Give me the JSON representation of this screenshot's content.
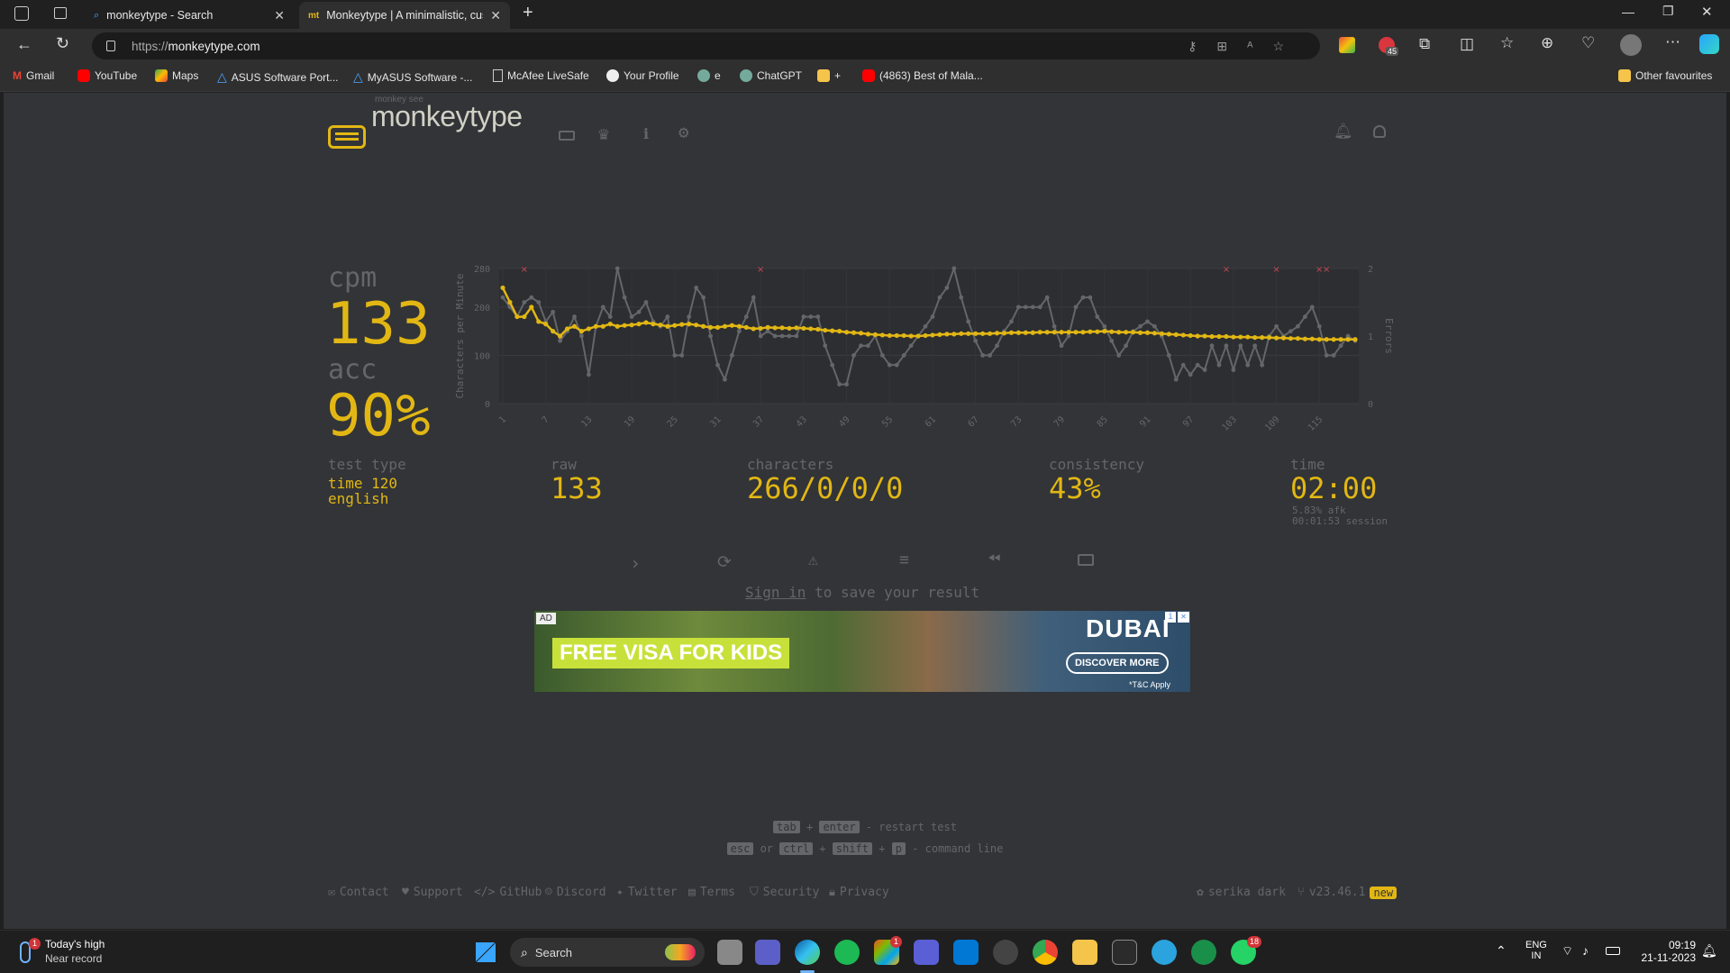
{
  "browser": {
    "tabs": [
      {
        "label": "monkeytype - Search",
        "favicon": "search-icon"
      },
      {
        "label": "Monkeytype | A minimalistic, cus",
        "favicon": "mt"
      }
    ],
    "url_prefix": "https://",
    "url_host": "monkeytype.com",
    "extension_badge": "45",
    "bookmarks": [
      "Gmail",
      "YouTube",
      "Maps",
      "ASUS Software Port...",
      "MyASUS Software -...",
      "McAfee LiveSafe",
      "Your Profile",
      "e",
      "ChatGPT",
      "+",
      "(4863) Best of Mala..."
    ],
    "other_favourites": "Other favourites"
  },
  "site": {
    "logo_top": "monkey see",
    "logo": "monkeytype"
  },
  "result": {
    "wpm_label": "cpm",
    "wpm": "133",
    "acc_label": "acc",
    "acc": "90%",
    "test_type_label": "test type",
    "test_type_1": "time 120",
    "test_type_2": "english",
    "raw_label": "raw",
    "raw": "133",
    "chars_label": "characters",
    "chars": "266/0/0/0",
    "consistency_label": "consistency",
    "consistency": "43%",
    "time_label": "time",
    "time": "02:00",
    "afk": "5.83% afk",
    "session": "00:01:53 session",
    "signin_link": "Sign in",
    "signin_rest": " to save your result"
  },
  "chart_data": {
    "type": "line",
    "ylabel": "Characters per Minute",
    "y2label": "Errors",
    "ylim": [
      0,
      280
    ],
    "y2lim": [
      0,
      2
    ],
    "yticks": [
      "280",
      "200",
      "100",
      "0"
    ],
    "y2ticks": [
      "2",
      "1",
      "0"
    ],
    "xticks": [
      "1",
      "7",
      "13",
      "19",
      "25",
      "31",
      "37",
      "43",
      "49",
      "55",
      "61",
      "67",
      "73",
      "79",
      "85",
      "91",
      "97",
      "103",
      "109",
      "115"
    ],
    "x": [
      1,
      120
    ],
    "series": [
      {
        "name": "",
        "color": "#e2b714",
        "values": [
          240,
          210,
          180,
          180,
          200,
          170,
          165,
          150,
          140,
          155,
          160,
          150,
          155,
          160,
          160,
          165,
          160,
          162,
          163,
          165,
          168,
          165,
          163,
          160,
          162,
          164,
          165,
          163,
          160,
          158,
          158,
          160,
          162,
          160,
          158,
          155,
          156,
          158,
          157,
          157,
          156,
          157,
          156,
          155,
          154,
          152,
          151,
          150,
          148,
          147,
          146,
          144,
          143,
          142,
          141,
          141,
          141,
          140,
          140,
          141,
          142,
          143,
          144,
          144,
          145,
          145,
          145,
          145,
          145,
          146,
          146,
          147,
          147,
          147,
          147,
          148,
          148,
          148,
          148,
          148,
          148,
          148,
          149,
          149,
          150,
          149,
          148,
          148,
          148,
          147,
          147,
          146,
          145,
          144,
          143,
          142,
          141,
          140,
          140,
          139,
          139,
          139,
          138,
          138,
          138,
          137,
          137,
          137,
          136,
          136,
          135,
          135,
          134,
          134,
          133,
          133,
          133,
          133,
          133,
          133
        ]
      },
      {
        "name": "",
        "color": "#646669",
        "values": [
          220,
          200,
          180,
          210,
          220,
          210,
          170,
          190,
          130,
          150,
          180,
          140,
          60,
          160,
          200,
          180,
          280,
          220,
          180,
          190,
          210,
          170,
          160,
          180,
          100,
          100,
          180,
          240,
          220,
          140,
          80,
          50,
          100,
          150,
          180,
          220,
          140,
          150,
          140,
          140,
          140,
          140,
          180,
          180,
          180,
          120,
          80,
          40,
          40,
          100,
          120,
          120,
          140,
          100,
          80,
          80,
          100,
          120,
          140,
          160,
          180,
          220,
          240,
          280,
          220,
          170,
          130,
          100,
          100,
          120,
          150,
          170,
          200,
          200,
          200,
          200,
          220,
          160,
          120,
          140,
          200,
          220,
          220,
          180,
          160,
          130,
          100,
          120,
          150,
          160,
          170,
          160,
          140,
          100,
          50,
          80,
          60,
          80,
          70,
          120,
          80,
          120,
          70,
          120,
          80,
          120,
          80,
          140,
          160,
          140,
          150,
          160,
          180,
          200,
          160,
          100,
          100,
          120,
          140,
          130
        ]
      },
      {
        "name": "",
        "color": "#ca4754",
        "values": [
          0,
          0,
          0,
          1,
          0,
          0,
          0,
          0,
          0,
          0,
          0,
          0,
          0,
          0,
          0,
          0,
          0,
          0,
          0,
          0,
          0,
          0,
          0,
          0,
          0,
          0,
          0,
          0,
          0,
          0,
          0,
          0,
          0,
          0,
          0,
          0,
          1,
          0,
          0,
          0,
          0,
          0,
          0,
          0,
          0,
          0,
          0,
          0,
          0,
          0,
          0,
          0,
          0,
          0,
          0,
          0,
          0,
          0,
          0,
          0,
          0,
          0,
          0,
          0,
          0,
          0,
          0,
          0,
          0,
          0,
          0,
          0,
          0,
          0,
          0,
          0,
          0,
          0,
          0,
          0,
          0,
          0,
          0,
          0,
          0,
          0,
          0,
          0,
          0,
          0,
          0,
          0,
          0,
          0,
          0,
          0,
          0,
          0,
          0,
          0,
          0,
          1,
          0,
          0,
          0,
          0,
          0,
          0,
          1,
          0,
          0,
          0,
          0,
          0,
          1,
          1,
          0,
          0,
          0,
          0
        ]
      }
    ]
  },
  "hints": {
    "tab": "tab",
    "plus": "+",
    "enter": "enter",
    "restart": "- restart test",
    "esc": "esc",
    "or": "or",
    "ctrl": "ctrl",
    "shift": "shift",
    "p": "p",
    "command": "- command line"
  },
  "footer": {
    "links": [
      "Contact",
      "Support",
      "GitHub",
      "Discord",
      "Twitter",
      "Terms",
      "Security",
      "Privacy"
    ],
    "theme": "serika dark",
    "version": "v23.46.1",
    "new_badge": "new"
  },
  "ad": {
    "tag": "AD",
    "headline": "FREE VISA FOR KIDS",
    "brand": "DUBAI",
    "cta": "DISCOVER MORE",
    "note": "*T&C Apply"
  },
  "taskbar": {
    "weather_1": "Today's high",
    "weather_2": "Near record",
    "weather_badge": "1",
    "search": "Search",
    "lang_1": "ENG",
    "lang_2": "IN",
    "time": "09:19",
    "date": "21-11-2023",
    "store_badge": "1",
    "whatsapp_badge": "18"
  }
}
